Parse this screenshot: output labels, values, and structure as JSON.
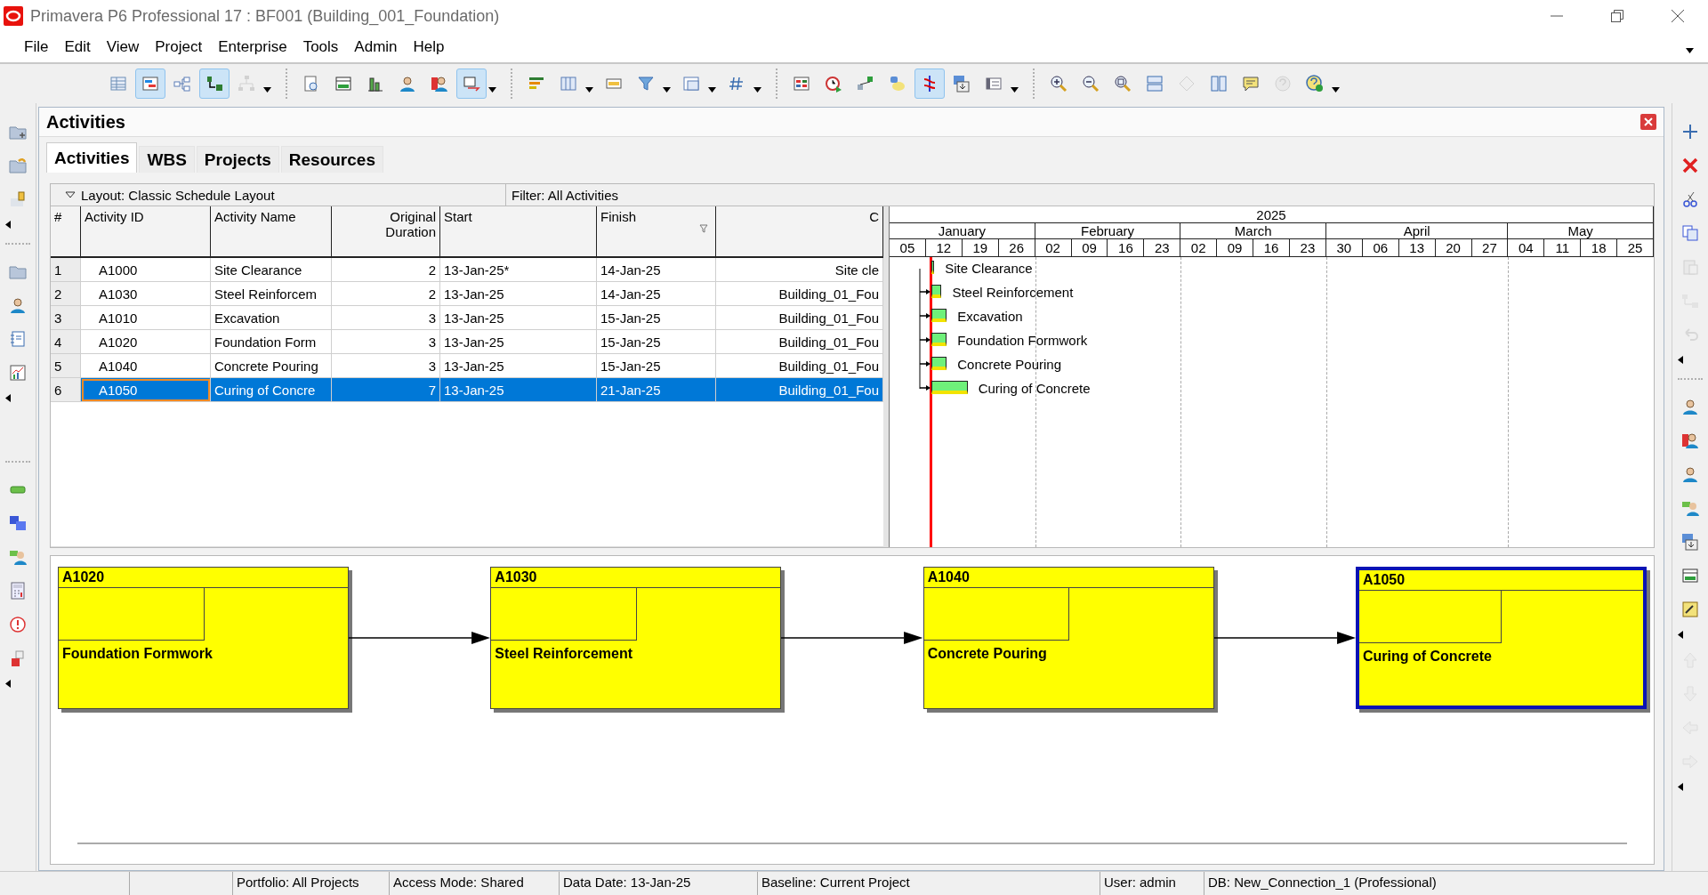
{
  "window": {
    "title": "Primavera P6 Professional 17 : BF001 (Building_001_Foundation)"
  },
  "menu": [
    "File",
    "Edit",
    "View",
    "Project",
    "Enterprise",
    "Tools",
    "Admin",
    "Help"
  ],
  "toolbar": [
    {
      "pressed": false,
      "disabled": false
    },
    {
      "pressed": true,
      "disabled": false
    },
    {
      "pressed": false,
      "disabled": false
    },
    {
      "pressed": true,
      "disabled": false
    },
    {
      "pressed": false,
      "disabled": true
    },
    {
      "pressed": false,
      "disabled": false
    },
    {
      "pressed": false,
      "disabled": false
    },
    {
      "pressed": false,
      "disabled": false
    },
    {
      "pressed": false,
      "disabled": false
    },
    {
      "pressed": false,
      "disabled": false
    },
    {
      "pressed": true,
      "disabled": false
    },
    {
      "pressed": false,
      "disabled": false
    },
    {
      "pressed": false,
      "disabled": false
    },
    {
      "pressed": false,
      "disabled": false
    },
    {
      "pressed": false,
      "disabled": false
    },
    {
      "pressed": false,
      "disabled": false
    },
    {
      "pressed": false,
      "disabled": false
    },
    {
      "pressed": false,
      "disabled": false
    },
    {
      "pressed": false,
      "disabled": false
    },
    {
      "pressed": false,
      "disabled": false
    },
    {
      "pressed": false,
      "disabled": false
    },
    {
      "pressed": true,
      "disabled": false
    },
    {
      "pressed": false,
      "disabled": false
    },
    {
      "pressed": false,
      "disabled": false
    },
    {
      "pressed": false,
      "disabled": false
    },
    {
      "pressed": false,
      "disabled": false
    },
    {
      "pressed": false,
      "disabled": false
    },
    {
      "pressed": false,
      "disabled": false
    },
    {
      "pressed": false,
      "disabled": true
    },
    {
      "pressed": false,
      "disabled": false
    },
    {
      "pressed": false,
      "disabled": false
    },
    {
      "pressed": false,
      "disabled": true
    },
    {
      "pressed": false,
      "disabled": false
    }
  ],
  "panel": {
    "title": "Activities"
  },
  "tabs": [
    {
      "label": "Activities",
      "selected": true
    },
    {
      "label": "WBS",
      "selected": false
    },
    {
      "label": "Projects",
      "selected": false
    },
    {
      "label": "Resources",
      "selected": false
    }
  ],
  "layout_bar": {
    "layout": "Layout: Classic Schedule Layout",
    "filter": "Filter: All Activities"
  },
  "table": {
    "columns": [
      "#",
      "Activity ID",
      "Activity Name",
      "Original Duration",
      "Start",
      "Finish",
      "C"
    ],
    "rows": [
      {
        "cells": [
          "1",
          "A1000",
          "Site Clearance",
          "2",
          "13-Jan-25*",
          "14-Jan-25",
          "Site cle"
        ],
        "selected": false
      },
      {
        "cells": [
          "2",
          "A1030",
          "Steel Reinforcem",
          "2",
          "13-Jan-25",
          "14-Jan-25",
          "Building_01_Fou"
        ],
        "selected": false
      },
      {
        "cells": [
          "3",
          "A1010",
          "Excavation",
          "3",
          "13-Jan-25",
          "15-Jan-25",
          "Building_01_Fou"
        ],
        "selected": false
      },
      {
        "cells": [
          "4",
          "A1020",
          "Foundation Form",
          "3",
          "13-Jan-25",
          "15-Jan-25",
          "Building_01_Fou"
        ],
        "selected": false
      },
      {
        "cells": [
          "5",
          "A1040",
          "Concrete Pouring",
          "3",
          "13-Jan-25",
          "15-Jan-25",
          "Building_01_Fou"
        ],
        "selected": false
      },
      {
        "cells": [
          "6",
          "A1050",
          "Curing of Concre",
          "7",
          "13-Jan-25",
          "21-Jan-25",
          "Building_01_Fou"
        ],
        "selected": true
      }
    ]
  },
  "gantt": {
    "year": "2025",
    "months": [
      {
        "label": "January",
        "weeks": [
          "05",
          "12",
          "19",
          "26"
        ]
      },
      {
        "label": "February",
        "weeks": [
          "02",
          "09",
          "16",
          "23"
        ]
      },
      {
        "label": "March",
        "weeks": [
          "02",
          "09",
          "16",
          "23"
        ]
      },
      {
        "label": "April",
        "weeks": [
          "30",
          "06",
          "13",
          "20",
          "27"
        ]
      },
      {
        "label": "May",
        "weeks": [
          "04",
          "11",
          "18",
          "25"
        ]
      }
    ],
    "bars": [
      {
        "label": "Site Clearance"
      },
      {
        "label": "Steel Reinforcement"
      },
      {
        "label": "Excavation"
      },
      {
        "label": "Foundation Formwork"
      },
      {
        "label": "Concrete Pouring"
      },
      {
        "label": "Curing of Concrete"
      }
    ]
  },
  "network": {
    "boxes": [
      {
        "id": "A1020",
        "name": "Foundation Formwork",
        "selected": false
      },
      {
        "id": "A1030",
        "name": "Steel Reinforcement",
        "selected": false
      },
      {
        "id": "A1040",
        "name": "Concrete Pouring",
        "selected": false
      },
      {
        "id": "A1050",
        "name": "Curing of Concrete",
        "selected": true
      }
    ]
  },
  "status_bar": [
    "Portfolio: All Projects",
    "Access Mode: Shared",
    "Data Date: 13-Jan-25",
    "Baseline: Current Project",
    "User: admin",
    "DB: New_Connection_1 (Professional)"
  ]
}
